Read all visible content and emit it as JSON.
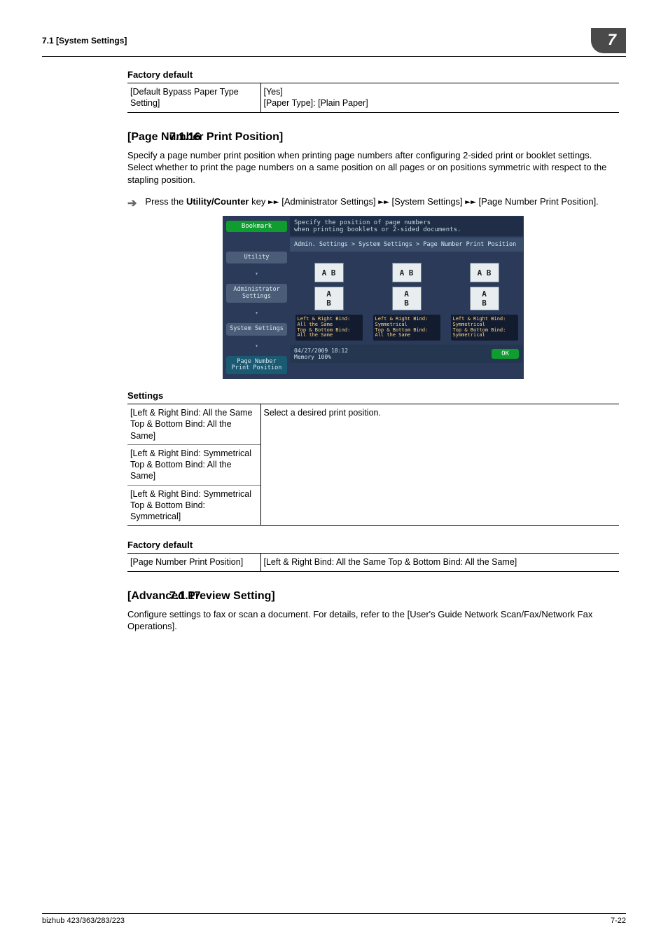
{
  "header": {
    "left": "7.1     [System Settings]",
    "chapter": "7"
  },
  "blocks": {
    "factory1": {
      "heading": "Factory default",
      "rows": [
        {
          "key": "[Default Bypass Paper Type Setting]",
          "val": "[Yes]\n[Paper Type]: [Plain Paper]"
        }
      ]
    },
    "s16": {
      "num": "7.1.16",
      "title": "[Page Number Print Position]",
      "para": "Specify a page number print position when printing page numbers after configuring 2-sided print or booklet settings. Select whether to print the page numbers on a same position on all pages or on positions symmetric with respect to the stapling position.",
      "step_prefix": "Press the ",
      "step_key": "Utility/Counter",
      "step_suffix1": " key ",
      "step_arrows": "►►",
      "step_path1": " [Administrator Settings] ",
      "step_path2": " [System Settings] ",
      "step_path3": " [Page Number Print Position]."
    },
    "ui": {
      "bookmark": "Bookmark",
      "nav_utility": "Utility",
      "nav_admin": "Administrator\nSettings",
      "nav_sys": "System Settings",
      "nav_pnpp": "Page Number\nPrint Position",
      "instr": "Specify the position of page numbers\nwhen printing booklets or 2-sided documents.",
      "crumb": "Admin. Settings > System Settings > Page Number Print Position",
      "opt_icon_top": "A B",
      "opt_icon_bot": "A\nB",
      "opt1": "Left & Right Bind:\nAll the Same\nTop & Bottom Bind:\nAll the Same",
      "opt2": "Left & Right Bind:\nSymmetrical\nTop & Bottom Bind:\nAll the Same",
      "opt3": "Left & Right Bind:\nSymmetrical\nTop & Bottom Bind:\nSymmetrical",
      "date": "04/27/2009   18:12",
      "memory": "Memory        100%",
      "ok": "OK"
    },
    "settings": {
      "heading": "Settings",
      "desc": "Select a desired print position.",
      "rows": [
        "[Left & Right Bind: All the Same Top & Bottom Bind: All the Same]",
        "[Left & Right Bind: Symmetrical Top & Bottom Bind: All the Same]",
        "[Left & Right Bind: Symmetrical Top & Bottom Bind: Symmetrical]"
      ]
    },
    "factory2": {
      "heading": "Factory default",
      "rows": [
        {
          "key": "[Page Number Print Position]",
          "val": "[Left & Right Bind: All the Same Top & Bottom Bind: All the Same]"
        }
      ]
    },
    "s17": {
      "num": "7.1.17",
      "title": "[Advanced Preview Setting]",
      "para": "Configure settings to fax or scan a document. For details, refer to the [User's Guide Network Scan/Fax/Network Fax Operations]."
    }
  },
  "footer": {
    "left": "bizhub 423/363/283/223",
    "right": "7-22"
  }
}
